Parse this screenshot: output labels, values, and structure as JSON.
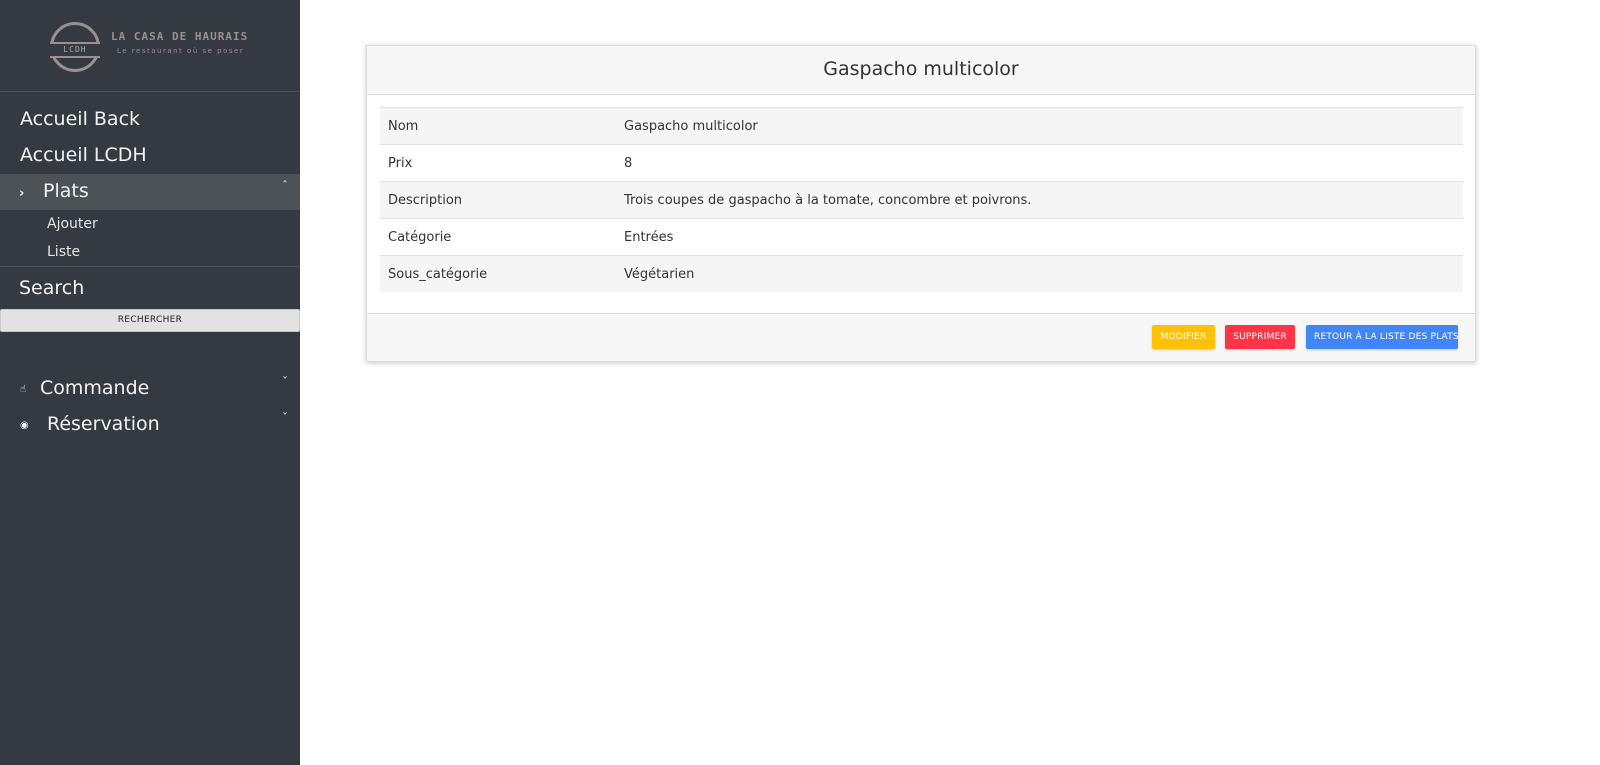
{
  "brand": {
    "logo_initials": "LCDH",
    "title": "LA CASA DE HAURAIS",
    "subtitle": "Le restaurant où se poser"
  },
  "sidebar": {
    "items": [
      {
        "label": "Accueil Back"
      },
      {
        "label": "Accueil LCDH"
      }
    ],
    "plats": {
      "label": "Plats",
      "icon": "chevron-right-icon",
      "caret": "chevron-up-icon",
      "subitems": [
        {
          "label": "Ajouter"
        },
        {
          "label": "Liste"
        }
      ]
    },
    "search": {
      "label": "Search",
      "button_label": "RECHERCHER"
    },
    "commande": {
      "label": "Commande",
      "icon": "hand-icon",
      "caret": "chevron-down-icon"
    },
    "reservation": {
      "label": "Réservation",
      "icon": "eye-icon",
      "caret": "chevron-down-icon"
    }
  },
  "card": {
    "title": "Gaspacho multicolor",
    "rows": [
      {
        "label": "Nom",
        "value": "Gaspacho multicolor"
      },
      {
        "label": "Prix",
        "value": "8"
      },
      {
        "label": "Description",
        "value": "Trois coupes de gaspacho à la tomate, concombre et poivrons."
      },
      {
        "label": "Catégorie",
        "value": "Entrées"
      },
      {
        "label": "Sous_catégorie",
        "value": "Végétarien"
      }
    ],
    "buttons": {
      "modify": "MODIFIER",
      "delete": "SUPPRIMER",
      "back": "RETOUR À LA LISTE DES PLATS"
    }
  },
  "colors": {
    "sidebar_bg": "#343a40",
    "modify_btn": "#ffc107",
    "delete_btn": "#ff3547",
    "back_btn": "#4285f4"
  }
}
